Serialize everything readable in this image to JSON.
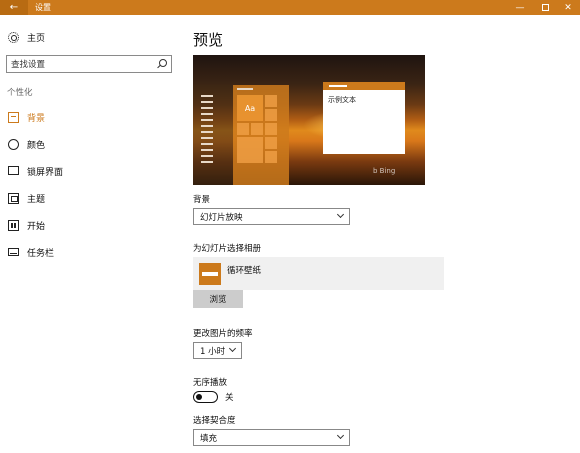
{
  "titlebar": {
    "title": "设置",
    "back_glyph": "←",
    "minimize_glyph": "—",
    "close_glyph": "✕"
  },
  "sidebar": {
    "home_label": "主页",
    "search_placeholder": "查找设置",
    "section_label": "个性化",
    "items": [
      {
        "label": "背景",
        "icon": "background-icon",
        "active": true
      },
      {
        "label": "颜色",
        "icon": "color-icon",
        "active": false
      },
      {
        "label": "锁屏界面",
        "icon": "lock-screen-icon",
        "active": false
      },
      {
        "label": "主题",
        "icon": "theme-icon",
        "active": false
      },
      {
        "label": "开始",
        "icon": "start-icon",
        "active": false
      },
      {
        "label": "任务栏",
        "icon": "taskbar-icon",
        "active": false
      }
    ]
  },
  "main": {
    "title": "预览",
    "preview": {
      "tile_text": "Aa",
      "window_text": "示例文本",
      "watermark": "b Bing"
    },
    "background_label": "背景",
    "background_value": "幻灯片放映",
    "album_label": "为幻灯片选择相册",
    "album_name": "循环壁纸",
    "browse_label": "浏览",
    "frequency_label": "更改图片的频率",
    "frequency_value": "1 小时",
    "shuffle_label": "无序播放",
    "shuffle_state": "关",
    "fit_label": "选择契合度",
    "fit_value": "填充"
  },
  "colors": {
    "accent": "#cc7a1c"
  }
}
